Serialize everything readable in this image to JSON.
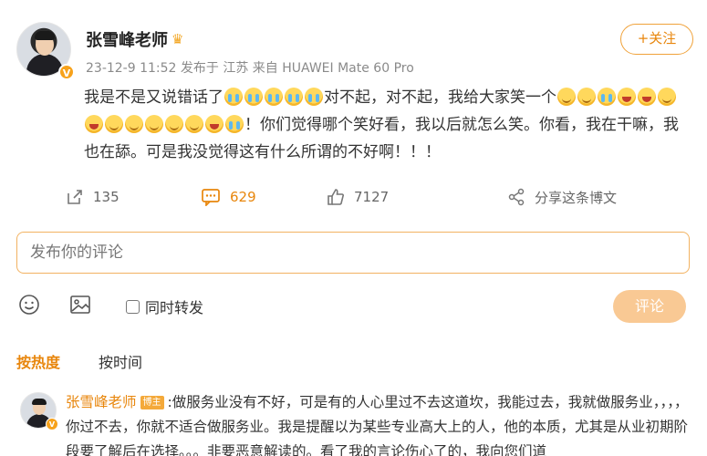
{
  "post": {
    "author": "张雪峰老师",
    "meta": "23-12-9 11:52 发布于 江苏 来自 HUAWEI Mate 60 Pro",
    "follow_label": "+关注",
    "verified_mark": "V",
    "text_part1": "我是不是又说错话了",
    "text_part2": "对不起，对不起，我给大家笑一个",
    "text_part3": "！你们觉得哪个笑好看，我以后就怎么笑。你看，我在干嘛，我也在舔。可是我没觉得这有什么所谓的不好啊！！！"
  },
  "actions": {
    "repost_count": "135",
    "comment_count": "629",
    "like_count": "7127",
    "share_label": "分享这条博文"
  },
  "compose": {
    "placeholder": "发布你的评论",
    "forward_label": "同时转发",
    "submit_label": "评论"
  },
  "sort": {
    "hot": "按热度",
    "time": "按时间"
  },
  "reply": {
    "author": "张雪峰老师",
    "tag": "博主",
    "verified_mark": "V",
    "text": ":做服务业没有不好，可是有的人心里过不去这道坎，我能过去，我就做服务业，，，，你过不去，你就不适合做服务业。我是提醒以为某些专业高大上的人，他的本质，尤其是从业初期阶段要了解后在选择。。。非要恶意解读的。看了我的言论伤心了的，我向您们道"
  },
  "colors": {
    "accent": "#e8860c",
    "input_border": "#f2b261",
    "submit_bg": "#f9c994"
  }
}
